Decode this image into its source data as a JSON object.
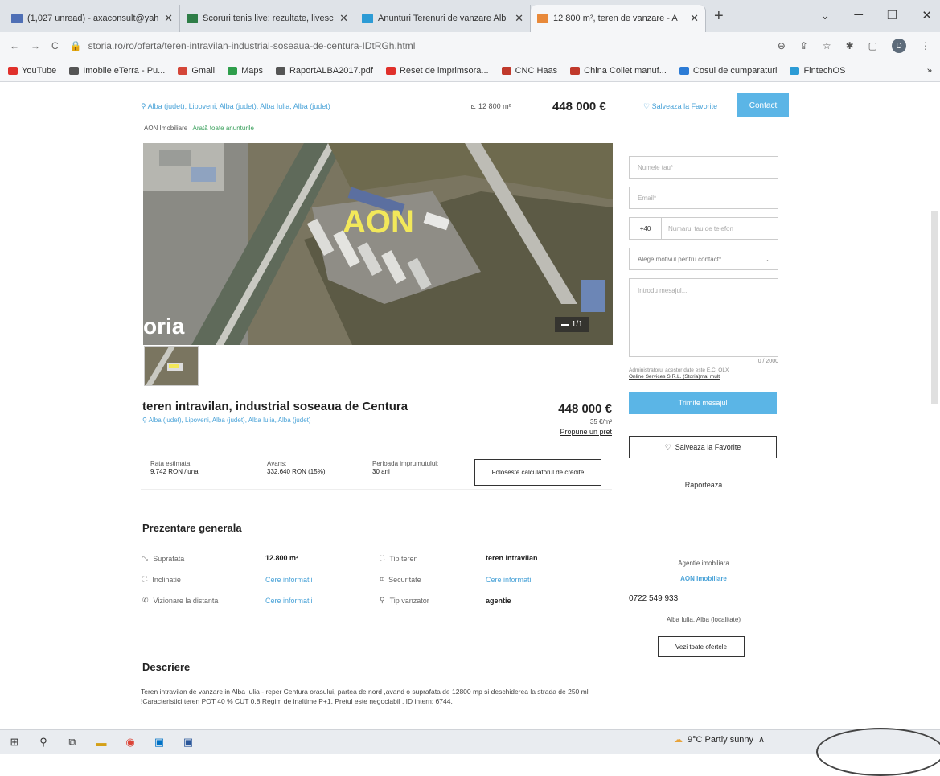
{
  "browser": {
    "tabs": [
      {
        "title": "(1,027 unread) - axaconsult@yah",
        "color": "#4f6fb5",
        "active": false
      },
      {
        "title": "Scoruri tenis live: rezultate, livesc",
        "color": "#2e7d47",
        "active": false
      },
      {
        "title": "Anunturi Terenuri de vanzare Alb",
        "color": "#2c9bd5",
        "active": false
      },
      {
        "title": "12 800 m², teren de vanzare - A",
        "color": "#e8893a",
        "active": true
      }
    ],
    "new_tab": "+",
    "url": "storia.ro/ro/oferta/teren-intravilan-industrial-soseaua-de-centura-IDtRGh.html",
    "profile_initial": "D",
    "bookmarks": [
      {
        "label": "YouTube",
        "color": "#e0302b"
      },
      {
        "label": "Imobile eTerra - Pu...",
        "color": "#555"
      },
      {
        "label": "Gmail",
        "color": "#d44638"
      },
      {
        "label": "Maps",
        "color": "#2e9e4b"
      },
      {
        "label": "RaportALBA2017.pdf",
        "color": "#555"
      },
      {
        "label": "Reset de imprimsora...",
        "color": "#e0302b"
      },
      {
        "label": "CNC Haas",
        "color": "#c0392b"
      },
      {
        "label": "China Collet manuf...",
        "color": "#c0392b"
      },
      {
        "label": "Cosul de cumparaturi",
        "color": "#2c7bd5"
      },
      {
        "label": "FintechOS",
        "color": "#2c9bd5"
      }
    ]
  },
  "header": {
    "location": "Alba (judet), Lipoveni, Alba (judet), Alba Iulia, Alba (judet)",
    "area": "12 800 m²",
    "price": "448 000 €",
    "save_fav": "Salveaza la Favorite",
    "contact": "Contact"
  },
  "agency": {
    "name": "AON Imobiliare",
    "all_ads": "Arată toate anunturile"
  },
  "photo": {
    "counter": "1/1",
    "logo": "AON",
    "watermark": "oria"
  },
  "listing": {
    "title": "teren intravilan, industrial soseaua de Centura",
    "location": "Alba (judet), Lipoveni, Alba (judet), Alba Iulia, Alba (judet)",
    "price": "448 000 €",
    "price_per_m": "35 €/m²",
    "propose": "Propune un pret"
  },
  "finance": {
    "rate_label": "Rata estimata:",
    "rate_value": "9.742 RON /luna",
    "advance_label": "Avans:",
    "advance_value": "332.640 RON (15%)",
    "period_label": "Perioada imprumutului:",
    "period_value": "30 ani",
    "calculator": "Foloseste calculatorul de credite"
  },
  "form": {
    "name_placeholder": "Numele tau*",
    "email_placeholder": "Email*",
    "phone_prefix": "+40",
    "phone_placeholder": "Numarul tau de telefon",
    "reason_placeholder": "Alege motivul pentru contact*",
    "message_placeholder": "Introdu mesajul...",
    "counter": "0 / 2000",
    "admin_text": "Administratorul acestor date este E.C. OLX",
    "admin_link": "Online Services S.R.L. (Storia)mai mult",
    "send": "Trimite mesajul",
    "save_fav": "Salveaza la Favorite",
    "report": "Raporteaza"
  },
  "overview": {
    "title": "Prezentare generala",
    "rows": [
      {
        "label": "Suprafata",
        "value": "12.800 m²",
        "label2": "Tip teren",
        "value2": "teren intravilan"
      },
      {
        "label": "Inclinatie",
        "value": "Cere informatii",
        "label2": "Securitate",
        "value2": "Cere informatii"
      },
      {
        "label": "Vizionare la distanta",
        "value": "Cere informatii",
        "label2": "Tip vanzator",
        "value2": "agentie"
      }
    ]
  },
  "agent_box": {
    "type": "Agentie imobiliara",
    "name": "AON Imobiliare",
    "phone": "0722 549 933",
    "city": "Alba Iulia, Alba (localitate)",
    "button": "Vezi toate ofertele"
  },
  "description": {
    "title": "Descriere",
    "text": "Teren intravilan de vanzare in Alba Iulia - reper Centura orasului, partea de nord ,avand o suprafata de 12800 mp si deschiderea la strada de 250 ml !Caracteristici teren POT 40 % CUT 0.8 Regim de inaltime P+1. Pretul este negociabil . ID intern: 6744."
  },
  "taskbar": {
    "weather": "9°C Partly sunny"
  }
}
